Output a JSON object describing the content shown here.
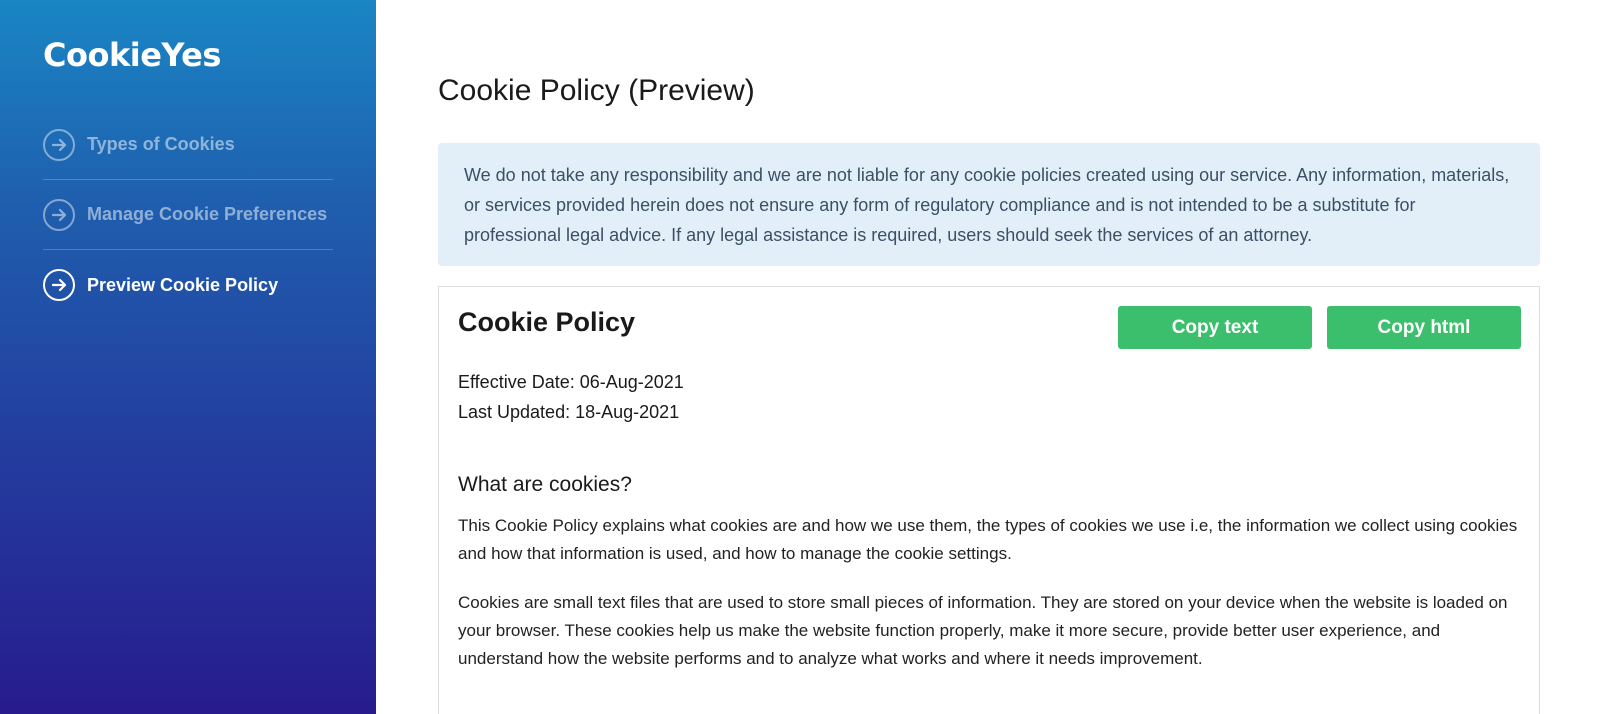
{
  "brand": {
    "logo_text": "CookieYes"
  },
  "sidebar": {
    "items": [
      {
        "label": "Types of Cookies",
        "icon": "arrow-right-circle-icon",
        "active": false
      },
      {
        "label": "Manage Cookie Preferences",
        "icon": "arrow-right-circle-icon",
        "active": false
      },
      {
        "label": "Preview Cookie Policy",
        "icon": "arrow-right-circle-icon",
        "active": true
      }
    ]
  },
  "main": {
    "title": "Cookie Policy (Preview)",
    "disclaimer": "We do not take any responsibility and we are not liable for any cookie policies created using our service. Any information, materials, or services provided herein does not ensure any form of regulatory compliance and is not intended to be a substitute for professional legal advice. If any legal assistance is required, users should seek the services of an attorney.",
    "policy": {
      "title": "Cookie Policy",
      "copy_text_label": "Copy text",
      "copy_html_label": "Copy html",
      "effective_date": "Effective Date: 06-Aug-2021",
      "last_updated": "Last Updated: 18-Aug-2021",
      "section_heading": "What are cookies?",
      "paragraphs": [
        "This Cookie Policy explains what cookies are and how we use them, the types of cookies we use i.e, the information we collect using cookies and how that information is used, and how to manage the cookie settings.",
        "Cookies are small text files that are used to store small pieces of information. They are stored on your device when the website is loaded on your browser. These cookies help us make the website function properly, make it more secure, provide better user experience, and understand how the website performs and to analyze what works and where it needs improvement."
      ]
    }
  },
  "colors": {
    "sidebar_top": "#1a86c4",
    "sidebar_bottom": "#271b8e",
    "button_green": "#3bbf6c",
    "disclaimer_bg": "#e2eff9",
    "disclaimer_text": "#3b4f66"
  }
}
